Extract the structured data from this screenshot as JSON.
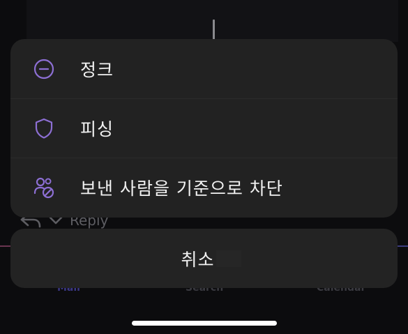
{
  "background": {
    "reply_label": "Reply",
    "tabs": [
      {
        "label": "Mail",
        "active": true
      },
      {
        "label": "Search",
        "active": false
      },
      {
        "label": "Calendar",
        "active": false
      }
    ]
  },
  "sheet": {
    "accent_color": "#8d6fd4",
    "items": [
      {
        "label": "정크",
        "icon": "minus-circle-icon"
      },
      {
        "label": "피싱",
        "icon": "shield-icon"
      },
      {
        "label": "보낸 사람을 기준으로 차단",
        "icon": "block-sender-icon"
      }
    ],
    "cancel_label": "취소"
  }
}
